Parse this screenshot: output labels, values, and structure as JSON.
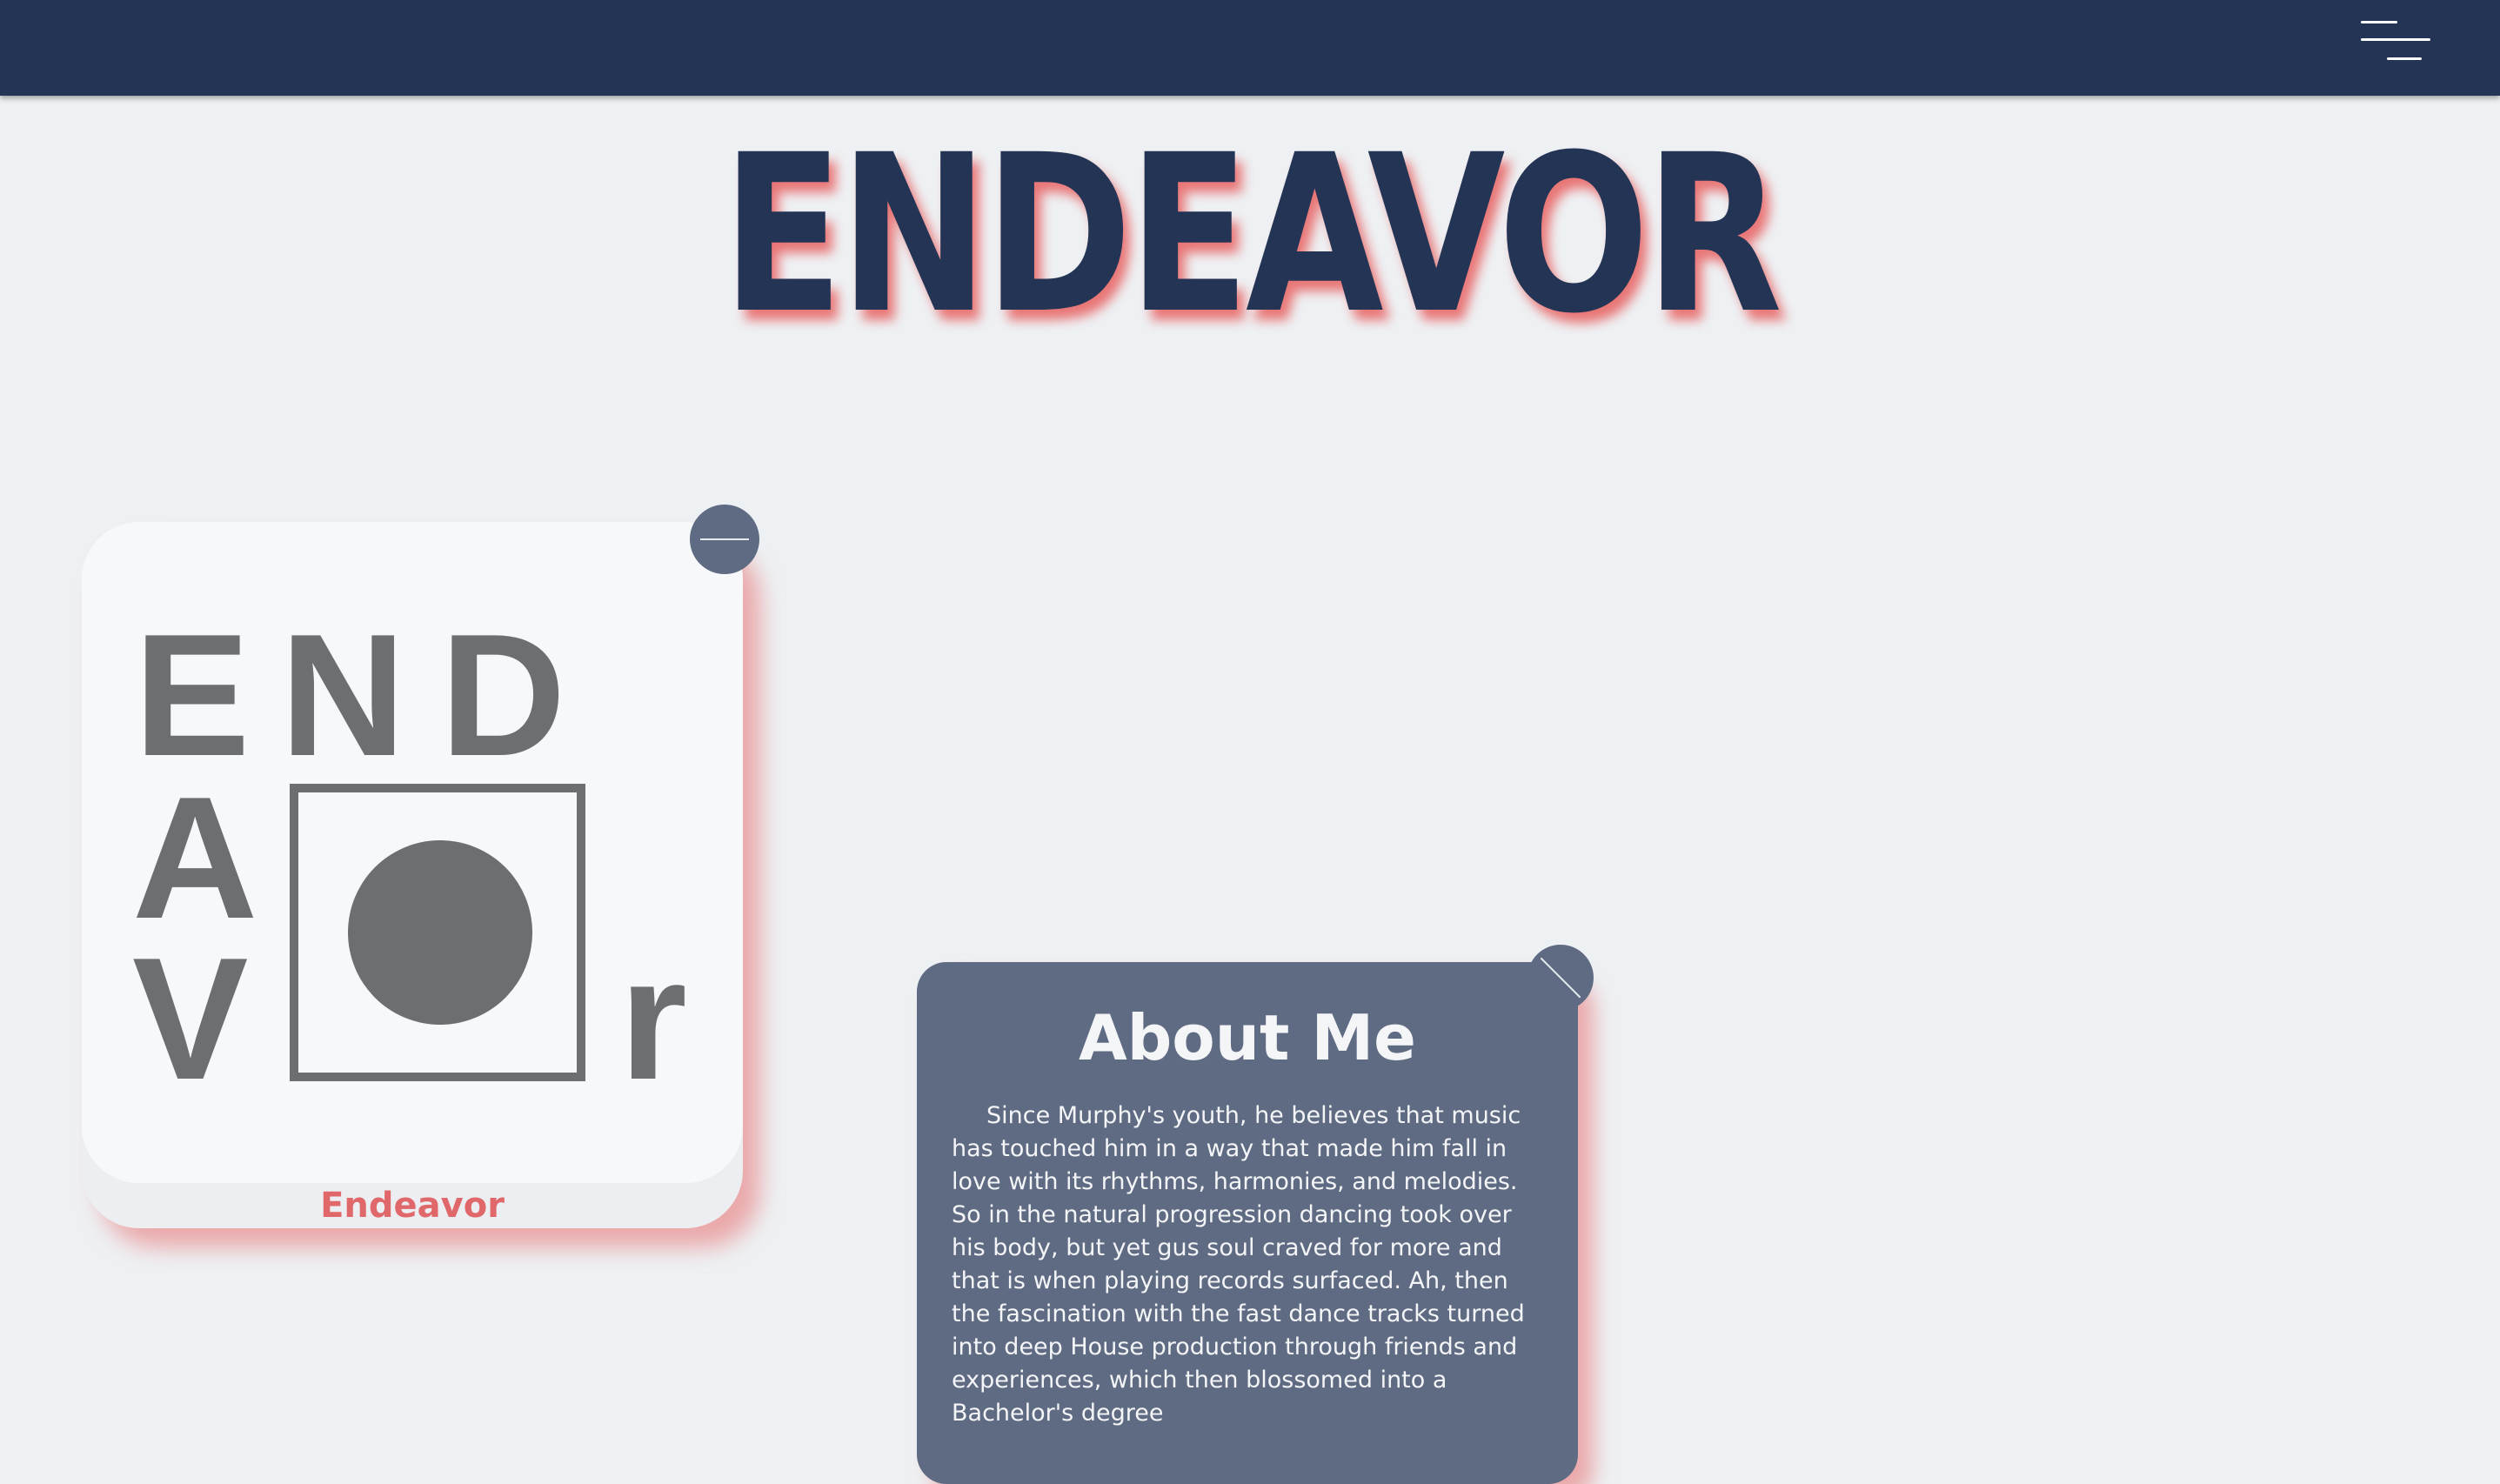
{
  "header": {
    "menu_icon": "hamburger-menu-icon"
  },
  "hero": {
    "title": "ENDEAVOR"
  },
  "logo_card": {
    "logo_letters": [
      "E",
      "N",
      "D",
      "A",
      "V",
      "r"
    ],
    "caption": "Endeavor",
    "minimize_icon": "minus-icon"
  },
  "about": {
    "title": "About Me",
    "body": "Since Murphy's youth, he believes that music has touched him in a way that made him fall in love with its rhythms, harmonies, and melodies. So in the natural progression dancing took over his body, but yet gus soul craved for more and that is when playing records surfaced. Ah, then the fascination with the fast dance tracks turned into deep House production through friends and experiences, which then blossomed into a Bachelor's degree",
    "close_icon": "close-icon"
  },
  "colors": {
    "navy": "#233455",
    "background": "#eef1f4",
    "card_slate": "#5f6b83",
    "accent_red": "#e0686a",
    "logo_gray": "#6d6e70"
  }
}
